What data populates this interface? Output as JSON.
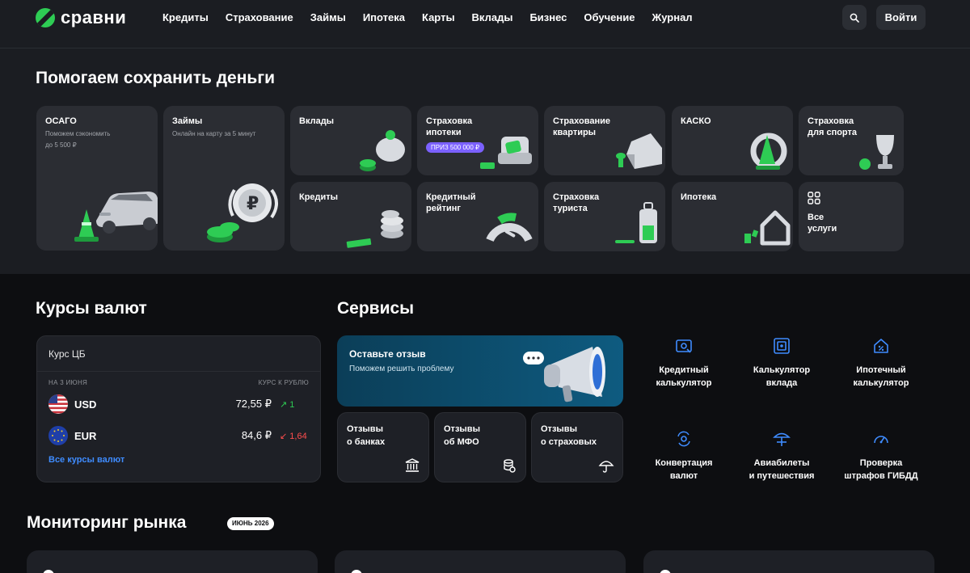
{
  "brand": {
    "name": "сравни"
  },
  "nav": {
    "items": [
      "Кредиты",
      "Страхование",
      "Займы",
      "Ипотека",
      "Карты",
      "Вклады",
      "Бизнес",
      "Обучение",
      "Журнал"
    ],
    "login_label": "Войти"
  },
  "savings": {
    "title": "Помогаем сохранить деньги",
    "tiles": [
      {
        "title": "ОСАГО",
        "subtitle": "Поможем сэкономить\nдо 5 500 ₽"
      },
      {
        "title": "Займы",
        "subtitle": "Онлайн на карту за 5 минут"
      },
      {
        "title": "Вклады"
      },
      {
        "title": "Страховка\nипотеки",
        "badge": "ПРИЗ 500 000 ₽"
      },
      {
        "title": "Страхование\nквартиры"
      },
      {
        "title": "КАСКО"
      },
      {
        "title": "Страховка\nдля спорта"
      },
      {
        "title": "Кредиты"
      },
      {
        "title": "Кредитный\nрейтинг"
      },
      {
        "title": "Страховка\nтуриста"
      },
      {
        "title": "Ипотека"
      },
      {
        "title": "Все\nуслуги"
      }
    ]
  },
  "currency": {
    "title": "Курсы валют",
    "card_title": "Курс ЦБ",
    "date_label": "НА 3 ИЮНЯ",
    "rate_label": "КУРС К РУБЛЮ",
    "rows": [
      {
        "code": "USD",
        "value": "72,55 ₽",
        "change": "↗ 1",
        "direction": "up"
      },
      {
        "code": "EUR",
        "value": "84,6 ₽",
        "change": "↙ 1,64",
        "direction": "down"
      }
    ],
    "all_link": "Все курсы валют"
  },
  "services": {
    "title": "Сервисы",
    "review": {
      "title": "Оставьте отзыв",
      "subtitle": "Поможем решить проблему"
    },
    "reviews": [
      {
        "label": "Отзывы\nо банках",
        "icon": "bank-icon"
      },
      {
        "label": "Отзывы\nоб МФО",
        "icon": "coins-icon"
      },
      {
        "label": "Отзывы\nо страховых",
        "icon": "umbrella-icon"
      }
    ],
    "tools": [
      {
        "label": "Кредитный\nкалькулятор",
        "icon": "credit-calculator-icon"
      },
      {
        "label": "Калькулятор\nвклада",
        "icon": "safe-icon"
      },
      {
        "label": "Ипотечный\nкалькулятор",
        "icon": "house-percent-icon"
      },
      {
        "label": "Конвертация\nвалют",
        "icon": "exchange-icon"
      },
      {
        "label": "Авиабилеты\nи путешествия",
        "icon": "beach-umbrella-icon"
      },
      {
        "label": "Проверка\nштрафов ГИБДД",
        "icon": "speedometer-icon"
      }
    ]
  },
  "market": {
    "title": "Мониторинг рынка",
    "period": "ИЮНЬ 2026"
  },
  "colors": {
    "accent_green": "#2ecc54",
    "link_blue": "#3f8cff",
    "badge_purple": "#7b61ff",
    "up": "#2ecc54",
    "down": "#ff4d4d"
  }
}
